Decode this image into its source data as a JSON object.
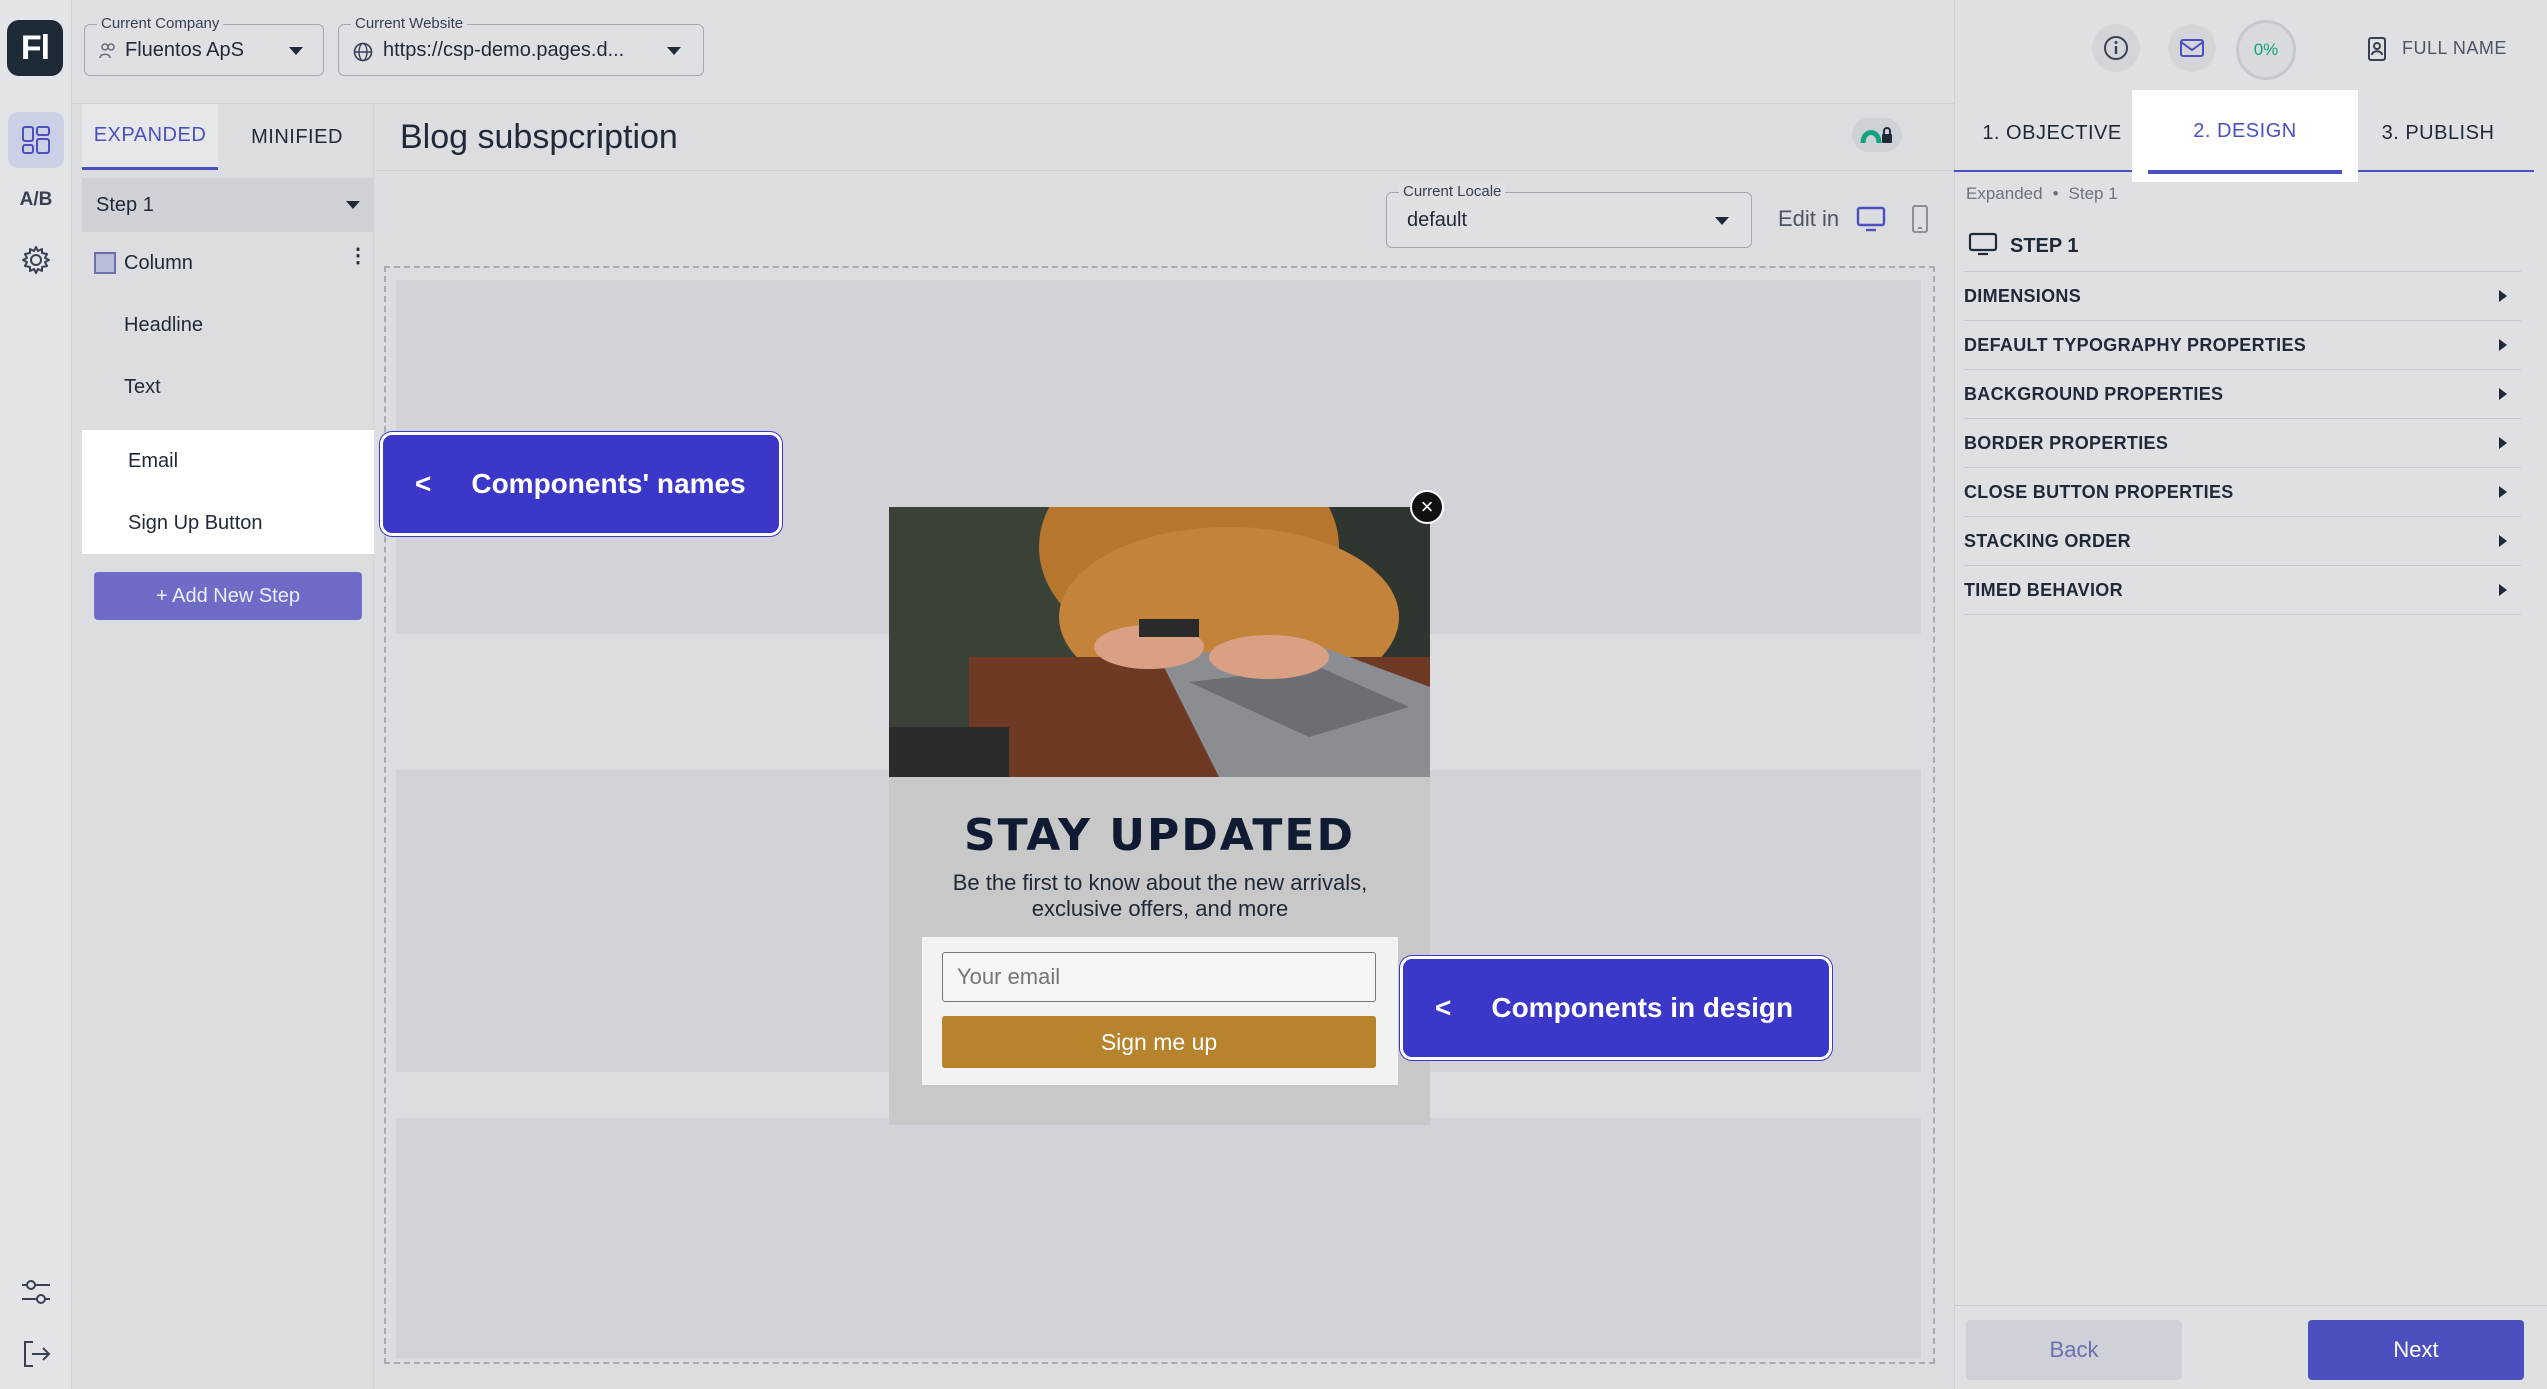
{
  "app": {
    "logo": "Fl"
  },
  "rail": {
    "ab_label": "A/B"
  },
  "topbar": {
    "company": {
      "legend": "Current Company",
      "value": "Fluentos ApS"
    },
    "website": {
      "legend": "Current Website",
      "value": "https://csp-demo.pages.d..."
    },
    "progress": "0%",
    "user": "FULL NAME"
  },
  "layers": {
    "tabs": [
      "EXPANDED",
      "MINIFIED"
    ],
    "step_select": "Step 1",
    "items": [
      "Column",
      "Headline",
      "Text",
      "Email",
      "Sign Up Button"
    ],
    "add_step": "+ Add New Step"
  },
  "canvas": {
    "title": "Blog subspcription",
    "locale": {
      "legend": "Current Locale",
      "value": "default"
    },
    "edit_in": "Edit in"
  },
  "popup": {
    "title": "STAY UPDATED",
    "subtitle": "Be the first to know about the new arrivals, exclusive offers, and more",
    "email_placeholder": "Your email",
    "button": "Sign me up",
    "close": "×"
  },
  "callouts": {
    "names": "Components' names",
    "design": "Components in design",
    "chevron": "<"
  },
  "right": {
    "steps": [
      "1. OBJECTIVE",
      "2. DESIGN",
      "3. PUBLISH"
    ],
    "breadcrumb": [
      "Expanded",
      "Step 1"
    ],
    "breadcrumb_sep": "•",
    "section": "STEP 1",
    "properties": [
      "DIMENSIONS",
      "DEFAULT TYPOGRAPHY PROPERTIES",
      "BACKGROUND PROPERTIES",
      "BORDER PROPERTIES",
      "CLOSE BUTTON PROPERTIES",
      "STACKING ORDER",
      "TIMED BEHAVIOR"
    ],
    "back": "Back",
    "next": "Next"
  },
  "colors": {
    "accent": "#4b4fbf",
    "callout": "#3a37c9",
    "signup": "#b7842d",
    "title": "#0f1b33"
  }
}
